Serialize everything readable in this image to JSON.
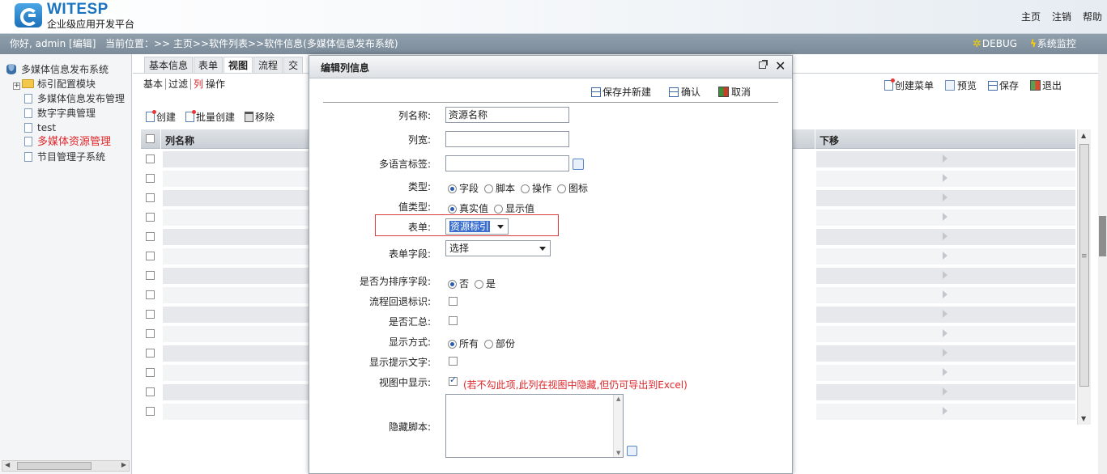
{
  "header": {
    "logo_title": "WITESP",
    "logo_subtitle": "企业级应用开发平台",
    "links": [
      "主页",
      "注销",
      "帮助"
    ]
  },
  "infobar": {
    "greeting": "你好, admin [编辑]",
    "location": "当前位置：>> 主页>>软件列表>>软件信息(多媒体信息发布系统)",
    "debug": "DEBUG",
    "monitor": "系统监控"
  },
  "sidebar": {
    "root": "多媒体信息发布系统",
    "items": [
      {
        "label": "标引配置模块",
        "type": "folder"
      },
      {
        "label": "多媒体信息发布管理",
        "type": "page"
      },
      {
        "label": "数字字典管理",
        "type": "page"
      },
      {
        "label": "test",
        "type": "page"
      },
      {
        "label": "多媒体资源管理",
        "type": "page",
        "active": true
      },
      {
        "label": "节目管理子系统",
        "type": "page"
      }
    ]
  },
  "main": {
    "tabs": [
      "基本信息",
      "表单",
      "视图",
      "流程",
      "交"
    ],
    "active_tab": "视图",
    "subtabs": [
      "基本",
      "过滤",
      "列",
      "操作"
    ],
    "active_subtab": "列",
    "right_toolbar": [
      "创建菜单",
      "预览",
      "保存",
      "退出"
    ],
    "actions": [
      "创建",
      "批量创建",
      "移除"
    ],
    "grid": {
      "col_name": "列名称",
      "col_down": "下移",
      "row_count": 14
    }
  },
  "modal": {
    "title": "编辑列信息",
    "toolbar": [
      "保存并新建",
      "确认",
      "取消"
    ],
    "fields": {
      "col_name_label": "列名称:",
      "col_name_value": "资源名称",
      "width_label": "列宽:",
      "width_value": "",
      "i18n_label": "多语言标签:",
      "i18n_value": "",
      "type_label": "类型:",
      "type_options": [
        "字段",
        "脚本",
        "操作",
        "图标"
      ],
      "type_selected": "字段",
      "value_type_label": "值类型:",
      "value_type_options": [
        "真实值",
        "显示值"
      ],
      "value_type_selected": "真实值",
      "form_label": "表单:",
      "form_value": "资源标引",
      "form_field_label": "表单字段:",
      "form_field_value": "选择",
      "sort_label": "是否为排序字段:",
      "sort_options": [
        "否",
        "是"
      ],
      "sort_selected": "否",
      "flow_back_label": "流程回退标识:",
      "summary_label": "是否汇总:",
      "display_mode_label": "显示方式:",
      "display_mode_options": [
        "所有",
        "部份"
      ],
      "display_mode_selected": "所有",
      "show_hint_label": "显示提示文字:",
      "view_show_label": "视图中显示:",
      "view_show_note": "(若不勾此项,此列在视图中隐藏,但仍可导出到Excel)",
      "hide_script_label": "隐藏脚本:"
    }
  },
  "colors": {
    "accent_blue": "#1b74bf",
    "active_red": "#e0262a",
    "infobar_bg": "#8595a3",
    "highlight_border": "#d93c3c"
  }
}
